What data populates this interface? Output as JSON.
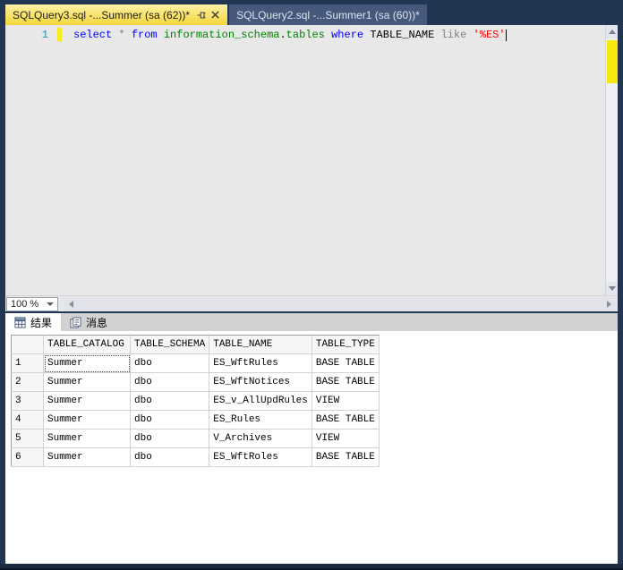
{
  "tabs": {
    "doc_tabs": [
      {
        "label": "SQLQuery3.sql -...Summer (sa (62))*",
        "state": "active"
      },
      {
        "label": "SQLQuery2.sql -...Summer1 (sa (60))*",
        "state": "inactive"
      }
    ]
  },
  "editor": {
    "line_number": "1",
    "sql_tokens": [
      {
        "text": "select ",
        "type": "keyword"
      },
      {
        "text": "* ",
        "type": "operator"
      },
      {
        "text": "from ",
        "type": "keyword"
      },
      {
        "text": "information_schema",
        "type": "sysobject"
      },
      {
        "text": ".",
        "type": "plain"
      },
      {
        "text": "tables ",
        "type": "sysobject"
      },
      {
        "text": "where ",
        "type": "keyword"
      },
      {
        "text": "TABLE_NAME ",
        "type": "plain"
      },
      {
        "text": "like ",
        "type": "operator"
      },
      {
        "text": "'%ES'",
        "type": "string"
      }
    ],
    "zoom_level": "100 %"
  },
  "results_pane": {
    "tabs": [
      {
        "label": "结果",
        "icon": "results-grid-icon",
        "selected": true
      },
      {
        "label": "消息",
        "icon": "messages-icon",
        "selected": false
      }
    ],
    "grid": {
      "columns": [
        "TABLE_CATALOG",
        "TABLE_SCHEMA",
        "TABLE_NAME",
        "TABLE_TYPE"
      ],
      "rows": [
        [
          "1",
          "Summer",
          "dbo",
          "ES_WftRules",
          "BASE TABLE"
        ],
        [
          "2",
          "Summer",
          "dbo",
          "ES_WftNotices",
          "BASE TABLE"
        ],
        [
          "3",
          "Summer",
          "dbo",
          "ES_v_AllUpdRules",
          "VIEW"
        ],
        [
          "4",
          "Summer",
          "dbo",
          "ES_Rules",
          "BASE TABLE"
        ],
        [
          "5",
          "Summer",
          "dbo",
          "V_Archives",
          "VIEW"
        ],
        [
          "6",
          "Summer",
          "dbo",
          "ES_WftRoles",
          "BASE TABLE"
        ]
      ]
    }
  },
  "colors": {
    "keyword": "#0000ff",
    "sysobject": "#008000",
    "string": "#ff0000",
    "operator": "#808080",
    "line_number": "#2b91af",
    "active_tab": "#f3d63c",
    "inactive_tab": "#46597c",
    "frame": "#223654",
    "change_bar": "#f8ee16"
  }
}
